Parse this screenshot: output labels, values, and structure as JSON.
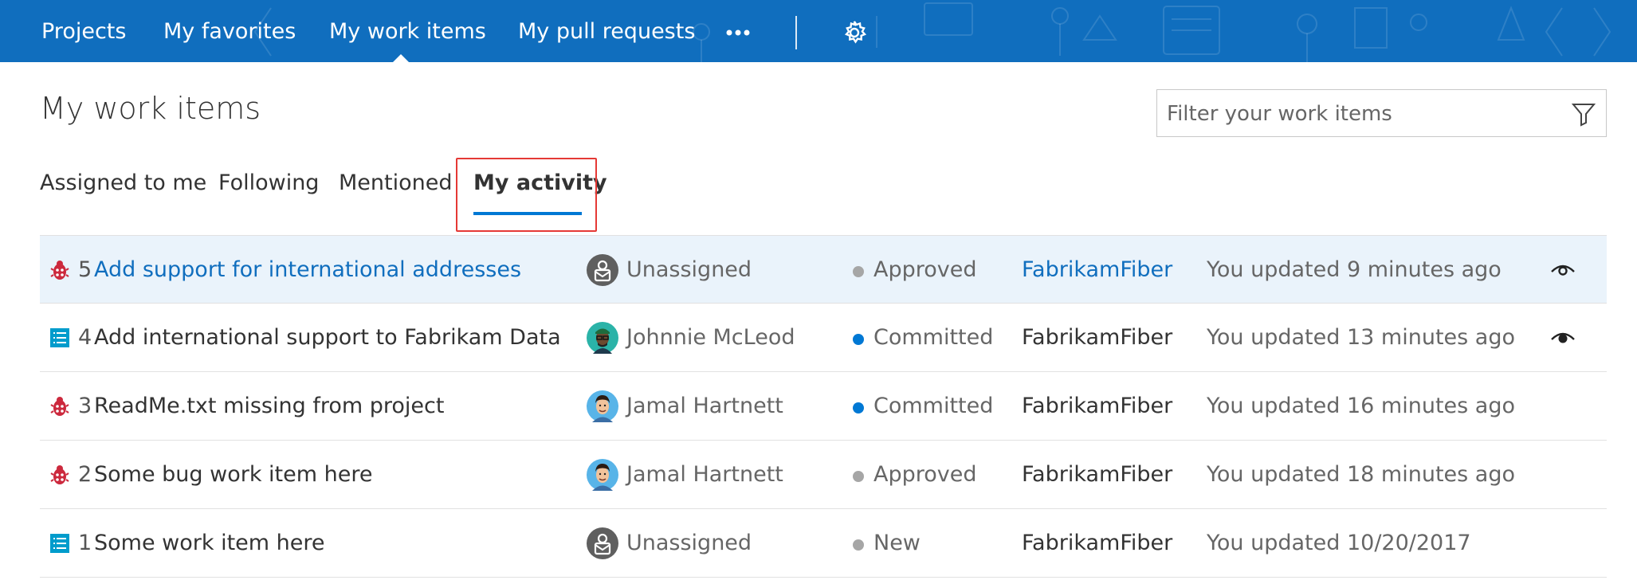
{
  "nav": {
    "items": [
      {
        "label": "Projects"
      },
      {
        "label": "My favorites"
      },
      {
        "label": "My work items"
      },
      {
        "label": "My pull requests"
      }
    ],
    "more_icon": "ellipsis-icon",
    "settings_icon": "gear-icon",
    "active_index": 2,
    "bar_color": "#106ebe"
  },
  "page": {
    "title": "My work items"
  },
  "filter": {
    "placeholder": "Filter your work items",
    "value": "",
    "icon": "funnel-icon"
  },
  "tabs": [
    {
      "label": "Assigned to me"
    },
    {
      "label": "Following"
    },
    {
      "label": "Mentioned"
    },
    {
      "label": "My activity",
      "active": true
    }
  ],
  "work_items": [
    {
      "type": "bug",
      "id": "5",
      "title": "Add support for international addresses",
      "assignee": "Unassigned",
      "avatar": "unassigned-avatar",
      "state": "Approved",
      "state_color": "#a6a6a6",
      "project": "FabrikamFiber",
      "updated": "You updated 9 minutes ago",
      "following": "eye-outline-icon",
      "selected": true
    },
    {
      "type": "backlog",
      "id": "4",
      "title": "Add international support to Fabrikam Data",
      "assignee": "Johnnie McLeod",
      "avatar": "johnnie-avatar",
      "state": "Committed",
      "state_color": "#0078d4",
      "project": "FabrikamFiber",
      "updated": "You updated 13 minutes ago",
      "following": "eye-filled-icon"
    },
    {
      "type": "bug",
      "id": "3",
      "title": "ReadMe.txt missing from project",
      "assignee": "Jamal Hartnett",
      "avatar": "jamal-avatar",
      "state": "Committed",
      "state_color": "#0078d4",
      "project": "FabrikamFiber",
      "updated": "You updated 16 minutes ago"
    },
    {
      "type": "bug",
      "id": "2",
      "title": "Some bug work item here",
      "assignee": "Jamal Hartnett",
      "avatar": "jamal-avatar",
      "state": "Approved",
      "state_color": "#a6a6a6",
      "project": "FabrikamFiber",
      "updated": "You updated 18 minutes ago"
    },
    {
      "type": "backlog",
      "id": "1",
      "title": "Some work item here",
      "assignee": "Unassigned",
      "avatar": "unassigned-avatar",
      "state": "New",
      "state_color": "#a6a6a6",
      "project": "FabrikamFiber",
      "updated": "You updated 10/20/2017"
    }
  ],
  "colors": {
    "link": "#106ebe",
    "selected_row": "#eaf3fb",
    "highlight": "#e53935",
    "bug_icon": "#cc293d",
    "backlog_icon": "#009ccc"
  }
}
